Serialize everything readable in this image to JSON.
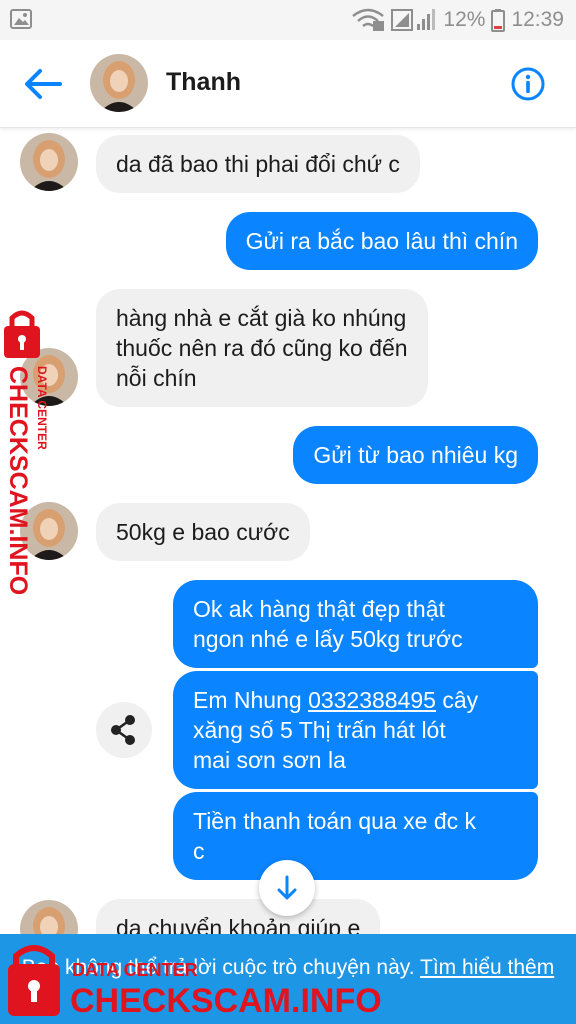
{
  "status_bar": {
    "battery": "12%",
    "time": "12:39",
    "icons": [
      "gallery-icon",
      "wifi-icon",
      "cell-signal-icon",
      "battery-icon"
    ]
  },
  "header": {
    "contact_name": "Thanh",
    "icons": [
      "back-arrow-icon",
      "info-icon"
    ]
  },
  "messages": [
    {
      "from": "contact",
      "text": "da đã bao thi phai đổi chứ c"
    },
    {
      "from": "me",
      "text": "Gửi ra bắc bao lâu thì chín"
    },
    {
      "from": "contact",
      "lines": [
        "hàng nhà e cắt già ko nhúng",
        "thuốc nên ra đó cũng ko đến",
        "nỗi chín"
      ]
    },
    {
      "from": "me",
      "text": "Gửi từ bao nhiêu kg"
    },
    {
      "from": "contact",
      "text": "50kg e bao cước"
    },
    {
      "from": "me",
      "lines": [
        "Ok ak hàng thật đẹp thật",
        "ngon nhé e lấy 50kg trước"
      ]
    },
    {
      "from": "me",
      "line1_prefix": "Em Nhung ",
      "phone": "0332388495",
      "line1_suffix": " cây",
      "lines": [
        "xăng số 5 Thị trấn hát lót",
        "mai sơn sơn la"
      ]
    },
    {
      "from": "me",
      "lines": [
        "Tiền thanh toán qua xe đc k",
        "c"
      ]
    },
    {
      "from": "contact",
      "text": "da chuyển khoản giúp e"
    }
  ],
  "banner": {
    "text": "Bạn không thể trả lời cuộc trò chuyện này.",
    "link": "Tìm hiểu thêm"
  },
  "watermark": {
    "site": "CHECKSCAM.INFO",
    "subtitle": "DATA CENTER"
  },
  "colors": {
    "outgoing_bubble": "#0a84ff",
    "incoming_bubble": "#f0f0f0",
    "banner": "#1e96e6",
    "watermark": "#e0141e"
  }
}
